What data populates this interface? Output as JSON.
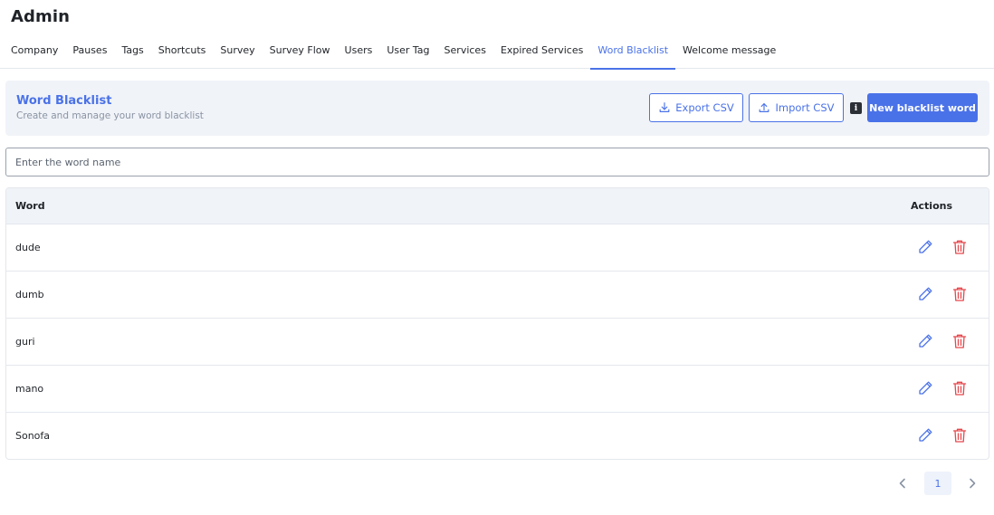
{
  "page": {
    "title": "Admin"
  },
  "tabs": [
    {
      "label": "Company",
      "active": false
    },
    {
      "label": "Pauses",
      "active": false
    },
    {
      "label": "Tags",
      "active": false
    },
    {
      "label": "Shortcuts",
      "active": false
    },
    {
      "label": "Survey",
      "active": false
    },
    {
      "label": "Survey Flow",
      "active": false
    },
    {
      "label": "Users",
      "active": false
    },
    {
      "label": "User Tag",
      "active": false
    },
    {
      "label": "Services",
      "active": false
    },
    {
      "label": "Expired Services",
      "active": false
    },
    {
      "label": "Word Blacklist",
      "active": true
    },
    {
      "label": "Welcome message",
      "active": false
    }
  ],
  "header": {
    "title": "Word Blacklist",
    "subtitle": "Create and manage your word blacklist",
    "export_label": "Export CSV",
    "import_label": "Import CSV",
    "info_icon_glyph": "i",
    "new_label": "New blacklist word"
  },
  "search": {
    "placeholder": "Enter the word name",
    "value": ""
  },
  "table": {
    "columns": {
      "word": "Word",
      "actions": "Actions"
    },
    "rows": [
      {
        "word": "dude"
      },
      {
        "word": "dumb"
      },
      {
        "word": "guri"
      },
      {
        "word": "mano"
      },
      {
        "word": "Sonofa"
      }
    ]
  },
  "pagination": {
    "current_page": "1"
  },
  "icons": {
    "export": "download-icon",
    "import": "upload-icon",
    "info": "info-icon",
    "edit": "pencil-icon",
    "delete": "trash-icon",
    "prev": "chevron-left-icon",
    "next": "chevron-right-icon"
  },
  "colors": {
    "accent": "#4a72e8",
    "danger": "#e5484d",
    "header_bg": "#f0f3f8",
    "text": "#1f2328",
    "muted": "#8a94a3"
  }
}
